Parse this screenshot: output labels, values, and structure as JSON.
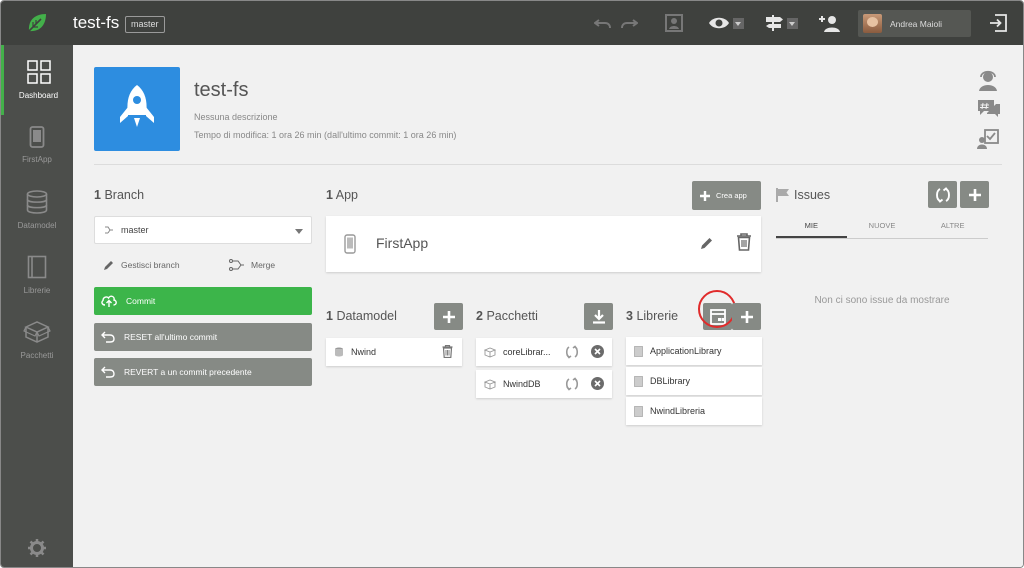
{
  "header": {
    "app_title": "test-fs",
    "branch_badge": "master",
    "user_name": "Andrea Maioli"
  },
  "sidebar": {
    "items": [
      {
        "label": "Dashboard",
        "icon": "dashboard-grid-icon",
        "active": true
      },
      {
        "label": "FirstApp",
        "icon": "phone-icon"
      },
      {
        "label": "Datamodel",
        "icon": "database-icon"
      },
      {
        "label": "Librerie",
        "icon": "book-icon"
      },
      {
        "label": "Pacchetti",
        "icon": "packages-icon"
      }
    ],
    "settings_icon": "gear-icon"
  },
  "project": {
    "title": "test-fs",
    "description": "Nessuna descrizione",
    "modified": "Tempo di modifica: 1 ora 26 min (dall'ultimo commit: 1 ora 26 min)"
  },
  "branch_section": {
    "count": "1",
    "title": "Branch",
    "selected_branch": "master",
    "manage_label": "Gestisci branch",
    "merge_label": "Merge",
    "commit_label": "Commit",
    "reset_label": "RESET all'ultimo commit",
    "revert_label": "REVERT a un commit precedente"
  },
  "app_section": {
    "count": "1",
    "title": "App",
    "create_label": "Crea app",
    "apps": [
      {
        "name": "FirstApp"
      }
    ]
  },
  "datamodel_section": {
    "count": "1",
    "title": "Datamodel",
    "items": [
      {
        "name": "Nwind"
      }
    ]
  },
  "packages_section": {
    "count": "2",
    "title": "Pacchetti",
    "items": [
      {
        "name": "coreLibrar..."
      },
      {
        "name": "NwindDB"
      }
    ]
  },
  "libraries_section": {
    "count": "3",
    "title": "Librerie",
    "items": [
      {
        "name": "ApplicationLibrary"
      },
      {
        "name": "DBLibrary"
      },
      {
        "name": "NwindLibreria"
      }
    ]
  },
  "issues_section": {
    "title": "Issues",
    "tabs": [
      "MIE",
      "NUOVE",
      "ALTRE"
    ],
    "empty_message": "Non ci sono issue da mostrare"
  },
  "colors": {
    "topbar": "#3f413e",
    "sidebar": "#4c4e4b",
    "accent_green": "#3cb54a",
    "button_grey": "#868a85",
    "app_icon_blue": "#2d8de0",
    "highlight_red": "#e02b2b"
  }
}
